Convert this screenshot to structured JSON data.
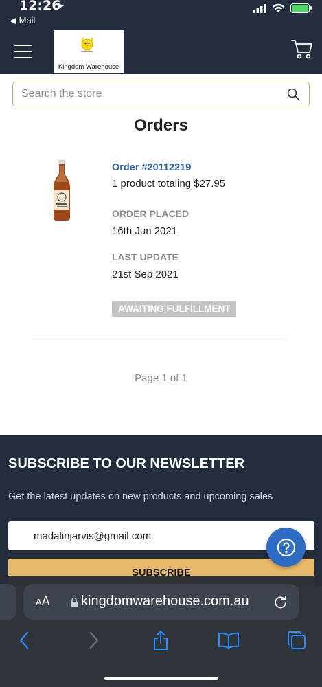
{
  "status_bar": {
    "time": "12:26",
    "back_label": "Mail"
  },
  "header": {
    "logo_text": "Kingdom Warehouse"
  },
  "search": {
    "placeholder": "Search the store"
  },
  "page": {
    "title": "Orders"
  },
  "order": {
    "number": "Order #20112219",
    "summary": "1 product totaling $27.95",
    "placed_label": "ORDER PLACED",
    "placed_date": "16th Jun 2021",
    "updated_label": "LAST UPDATE",
    "updated_date": "21st Sep 2021",
    "status": "AWAITING FULFILLMENT"
  },
  "pagination": {
    "text": "Page 1 of 1"
  },
  "newsletter": {
    "title": "SUBSCRIBE TO OUR NEWSLETTER",
    "description": "Get the latest updates on new products and upcoming sales",
    "email_value": "madalinjarvis@gmail.com",
    "subscribe_label": "SUBSCRIBE"
  },
  "browser": {
    "aa_label_small": "A",
    "aa_label": "A",
    "url": "kingdomwarehouse.com.au"
  },
  "colors": {
    "header_bg": "#232d3d",
    "accent_gold": "#e7b96a",
    "link_blue": "#2f5fa4",
    "help_blue": "#2e6cc4"
  }
}
